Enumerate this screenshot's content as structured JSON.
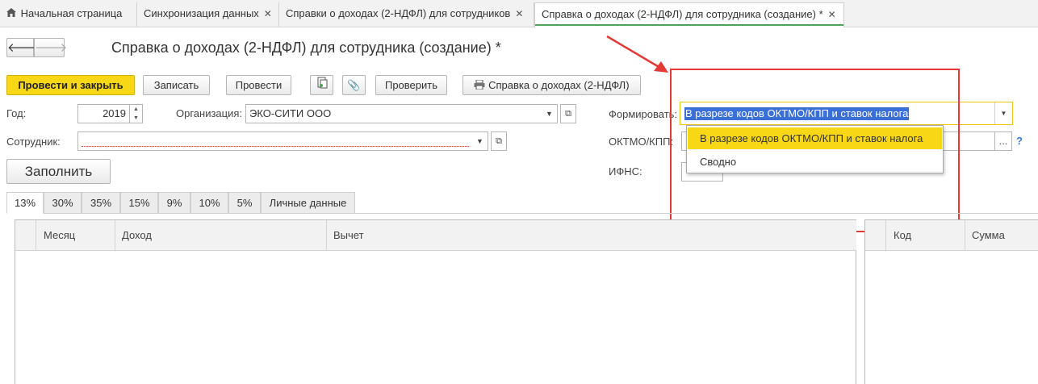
{
  "tabs": [
    {
      "label": "Начальная страница"
    },
    {
      "label": "Синхронизация данных"
    },
    {
      "label": "Справки о доходах (2-НДФЛ) для сотрудников"
    },
    {
      "label": "Справка о доходах (2-НДФЛ) для сотрудника (создание) *"
    }
  ],
  "page_title": "Справка о доходах (2-НДФЛ) для сотрудника (создание) *",
  "toolbar": {
    "post_close": "Провести и закрыть",
    "save": "Записать",
    "post": "Провести",
    "check": "Проверить",
    "print_report": "Справка о доходах (2-НДФЛ)"
  },
  "form": {
    "year_label": "Год:",
    "year_value": "2019",
    "org_label": "Организация:",
    "org_value": "ЭКО-СИТИ ООО",
    "employee_label": "Сотрудник:",
    "employee_value": "",
    "fill_button": "Заполнить",
    "form_label": "Формировать:",
    "form_value": "В разрезе кодов ОКТМО/КПП и ставок налога",
    "oktmo_label": "ОКТМО/КПП:",
    "ifns_label": "ИФНС:",
    "help": "?"
  },
  "dropdown": {
    "options": [
      "В разрезе кодов ОКТМО/КПП и ставок налога",
      "Сводно"
    ],
    "selected_index": 0
  },
  "rate_tabs": [
    "13%",
    "30%",
    "35%",
    "15%",
    "9%",
    "10%",
    "5%",
    "Личные данные"
  ],
  "grid": {
    "columns": [
      "Месяц",
      "Доход",
      "Вычет"
    ]
  },
  "grid2": {
    "columns": [
      "Код",
      "Сумма"
    ]
  },
  "colors": {
    "primary_button": "#f7d716",
    "annotation_red": "#e53935",
    "selection_blue": "#3b6fd8",
    "active_tab_underline": "#4ea35a"
  }
}
